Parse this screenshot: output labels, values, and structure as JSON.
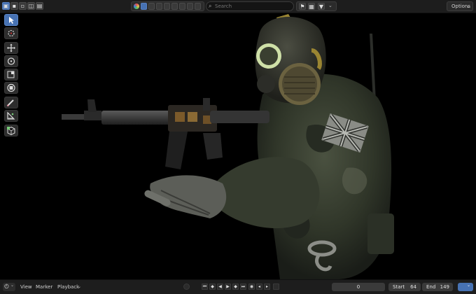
{
  "header": {
    "search": {
      "placeholder": "Search"
    },
    "options_label": "Options"
  },
  "timeline": {
    "menu_view": "View",
    "menu_marker": "Marker",
    "menu_playback": "Playback",
    "current_frame": "0",
    "start_label": "Start",
    "start_value": "64",
    "end_label": "End",
    "end_value": "149"
  },
  "toolbar": {
    "tools": [
      "select-box",
      "cursor",
      "move",
      "rotate",
      "scale",
      "transform",
      "annotate",
      "measure",
      "add-cube"
    ]
  },
  "colors": {
    "accent": "#4772b3",
    "header_bg": "#1d1d1d",
    "viewport_bg": "#000000"
  }
}
